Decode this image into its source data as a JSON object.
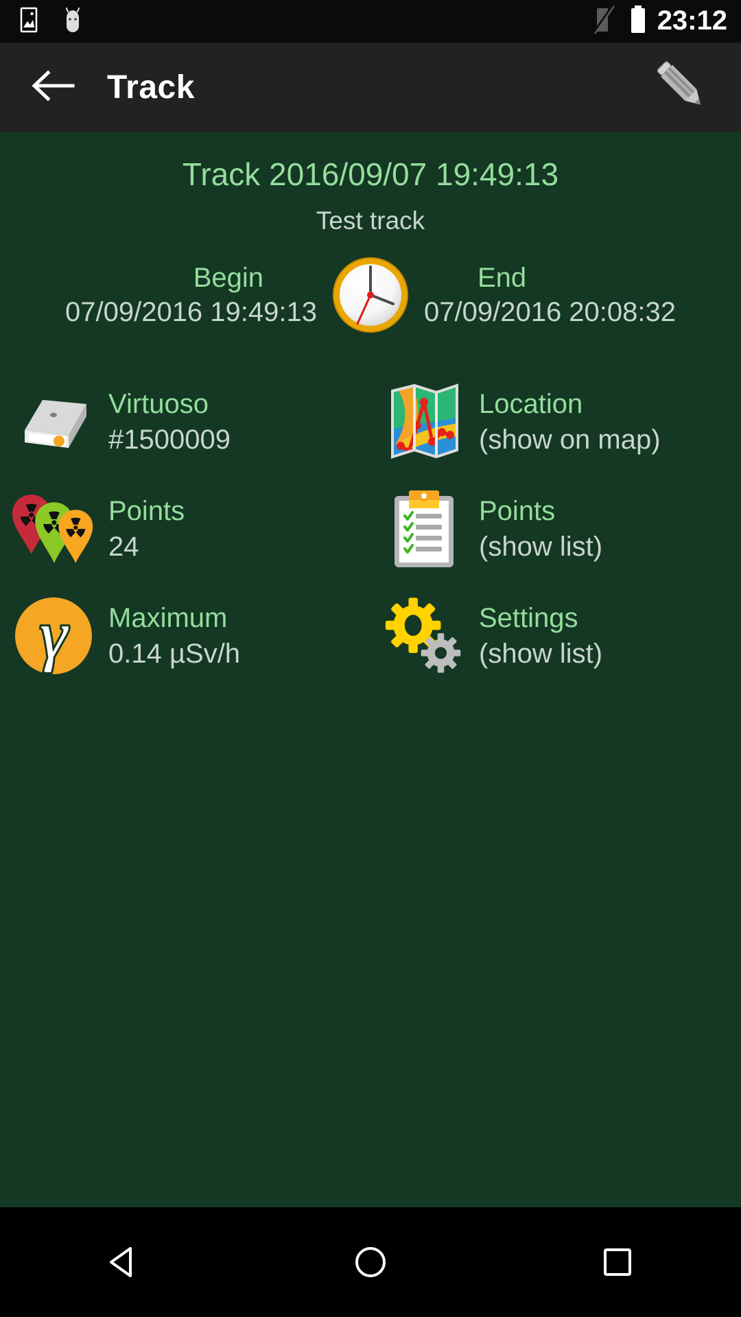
{
  "statusbar": {
    "clock": "23:12",
    "icons": [
      {
        "name": "gallery-image-icon"
      },
      {
        "name": "android-head-icon"
      },
      {
        "name": "signal-off-icon"
      },
      {
        "name": "battery-full-icon"
      }
    ]
  },
  "actionbar": {
    "back_label": "back-arrow",
    "title": "Track",
    "edit_label": "edit-pencil"
  },
  "track": {
    "title": "Track 2016/09/07 19:49:13",
    "subtitle": "Test track",
    "begin_label": "Begin",
    "begin_value": "07/09/2016 19:49:13",
    "end_label": "End",
    "end_value": "07/09/2016 20:08:32"
  },
  "items": [
    {
      "icon": "device-box-icon",
      "label": "Virtuoso",
      "value": "#1500009"
    },
    {
      "icon": "folded-map-icon",
      "label": "Location",
      "value": "(show on map)"
    },
    {
      "icon": "radiation-markers-icon",
      "label": "Points",
      "value": "24"
    },
    {
      "icon": "clipboard-checklist-icon",
      "label": "Points",
      "value": "(show list)"
    },
    {
      "icon": "gamma-circle-icon",
      "label": "Maximum",
      "value": "0.14 µSv/h"
    },
    {
      "icon": "gears-icon",
      "label": "Settings",
      "value": "(show list)"
    }
  ],
  "navbar": {
    "back": "nav-back-triangle",
    "home": "nav-home-circle",
    "recents": "nav-recents-square"
  },
  "colors": {
    "background": "#143823",
    "accent_green": "#95dd9d",
    "text_gray": "#c8d6cb",
    "statusbar": "#0b0b0b",
    "actionbar": "#222222",
    "orange": "#f5a623",
    "yellow": "#ffd200"
  }
}
